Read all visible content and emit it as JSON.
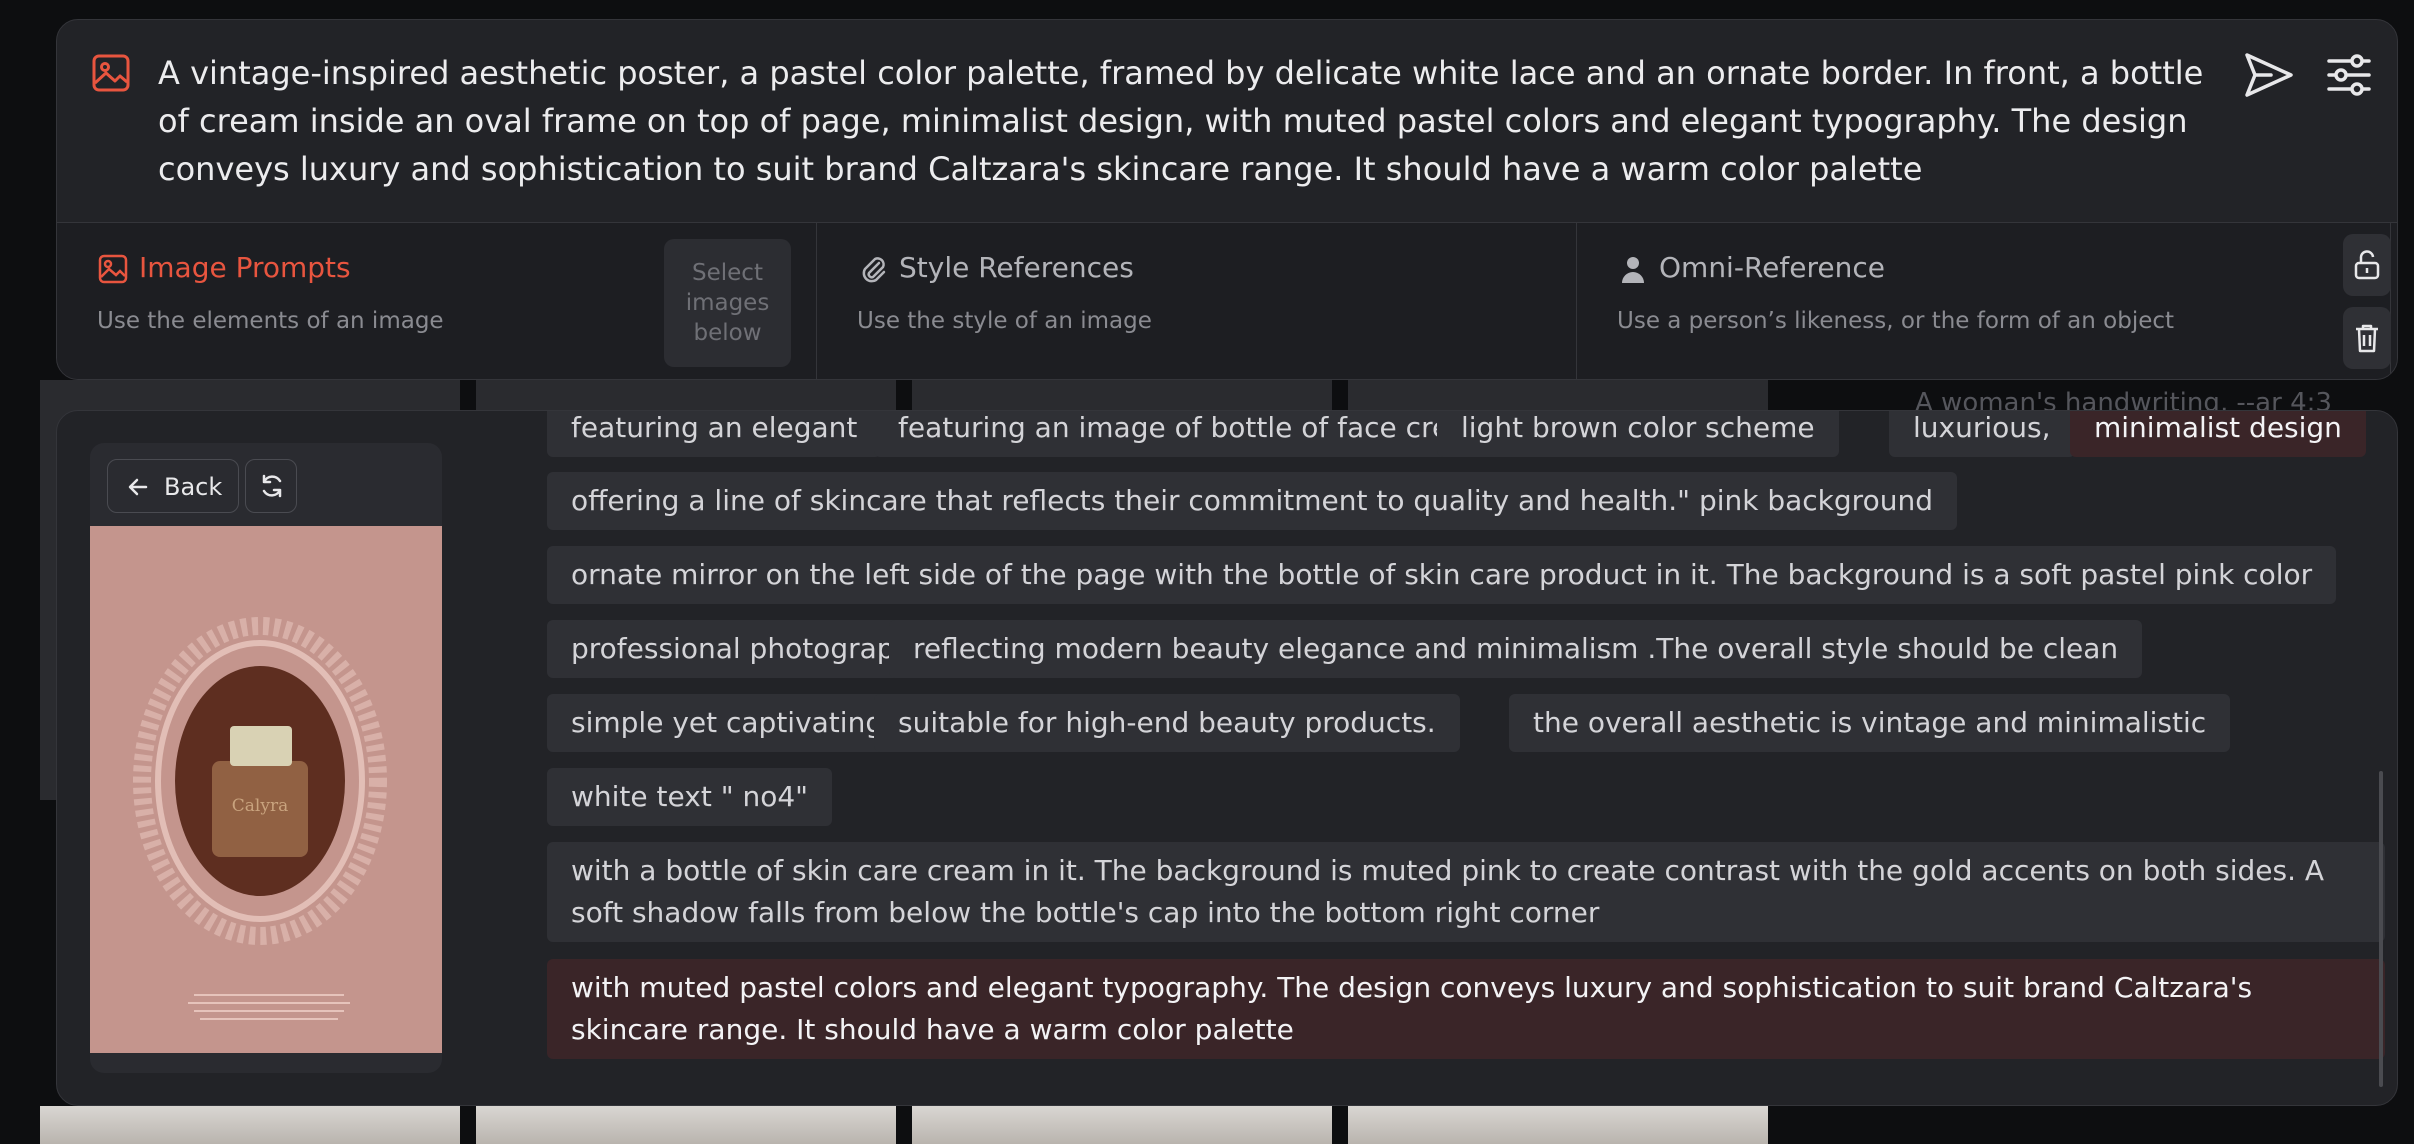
{
  "prompt": {
    "text": "A vintage-inspired aesthetic poster, a pastel color palette, framed by delicate white lace and an ornate border. In front, a bottle of cream inside an oval frame on top of page, minimalist design, with muted pastel colors and elegant typography. The design conveys luxury and sophistication to suit brand Caltzara's skincare range. It should have a warm color palette"
  },
  "references": {
    "image_prompts": {
      "title": "Image Prompts",
      "subtitle": "Use the elements of an image",
      "select_label": "Select images below"
    },
    "style": {
      "title": "Style References",
      "subtitle": "Use the style of an image"
    },
    "omni": {
      "title": "Omni-Reference",
      "subtitle": "Use a person’s likeness, or the form of an object"
    }
  },
  "preview": {
    "back_label": "Back",
    "bottle_label": "Calyra"
  },
  "background_ghost_text": "A woman's handwriting, --ar 4:3",
  "suggestions": [
    {
      "text": "featuring an elegant",
      "selected": false
    },
    {
      "text": "featuring an image of bottle of face cream",
      "selected": false
    },
    {
      "text": "light brown color scheme",
      "selected": false
    },
    {
      "text": "luxurious,",
      "selected": false
    },
    {
      "text": "minimalist design",
      "selected": true
    },
    {
      "text": "offering a line of skincare that reflects their commitment to quality and health.\" pink background",
      "selected": false
    },
    {
      "text": "ornate mirror on the left side of the page with the bottle of skin care product in it. The background is a soft pastel pink color",
      "selected": false
    },
    {
      "text": "professional photography",
      "selected": false
    },
    {
      "text": "reflecting modern beauty elegance and minimalism .The overall style should be clean",
      "selected": false
    },
    {
      "text": "simple yet captivating.",
      "selected": false
    },
    {
      "text": "suitable for high-end beauty products.",
      "selected": false
    },
    {
      "text": "the overall aesthetic is vintage and minimalistic",
      "selected": false
    },
    {
      "text": "white text \" no4\"",
      "selected": false
    },
    {
      "text": "with a bottle of skin care cream in it. The background is muted pink to create contrast with the gold accents on both sides. A soft shadow falls from below the bottle's cap into the bottom right corner",
      "selected": false
    },
    {
      "text": "with muted pastel colors and elegant typography. The design conveys luxury and sophistication to suit brand Caltzara's skincare range. It should have a warm color palette",
      "selected": true
    }
  ],
  "colors": {
    "accent": "#e8553f",
    "panel": "#222327",
    "chip": "#2f3035",
    "chip_selected": "#3a2528"
  }
}
